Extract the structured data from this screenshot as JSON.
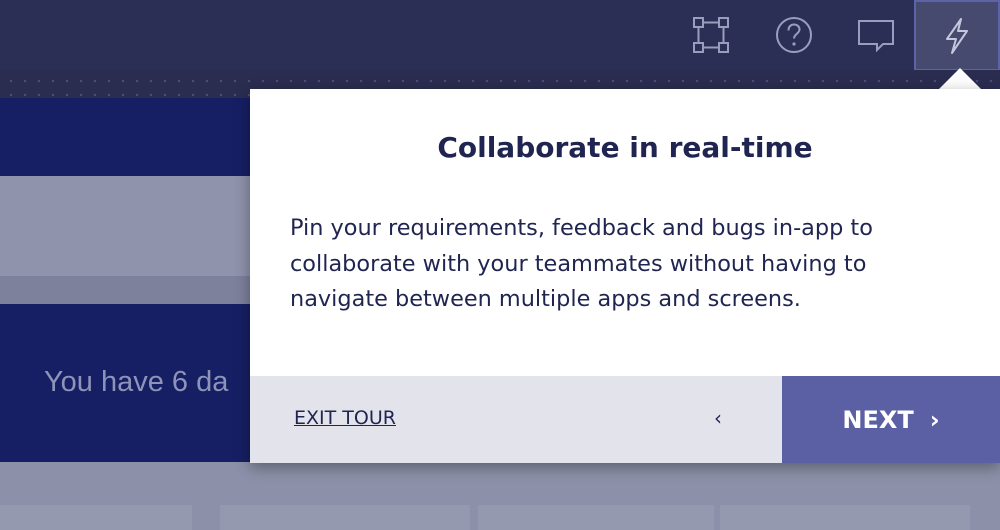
{
  "header": {
    "icons": [
      "component-tree-icon",
      "help-icon",
      "comment-icon",
      "lightning-icon"
    ]
  },
  "background": {
    "trial_text": "You have 6 da"
  },
  "tour": {
    "title": "Collaborate in real-time",
    "body": "Pin your requirements, feedback and bugs in-app to collaborate with your teammates without having to navigate between multiple apps and screens.",
    "exit_label": "EXIT TOUR",
    "prev_label": "‹",
    "next_label": "NEXT",
    "next_chevron": "›"
  },
  "colors": {
    "topbar": "#2c2f55",
    "navy": "#161f63",
    "accent": "#5a60a3",
    "text": "#1f2550"
  }
}
